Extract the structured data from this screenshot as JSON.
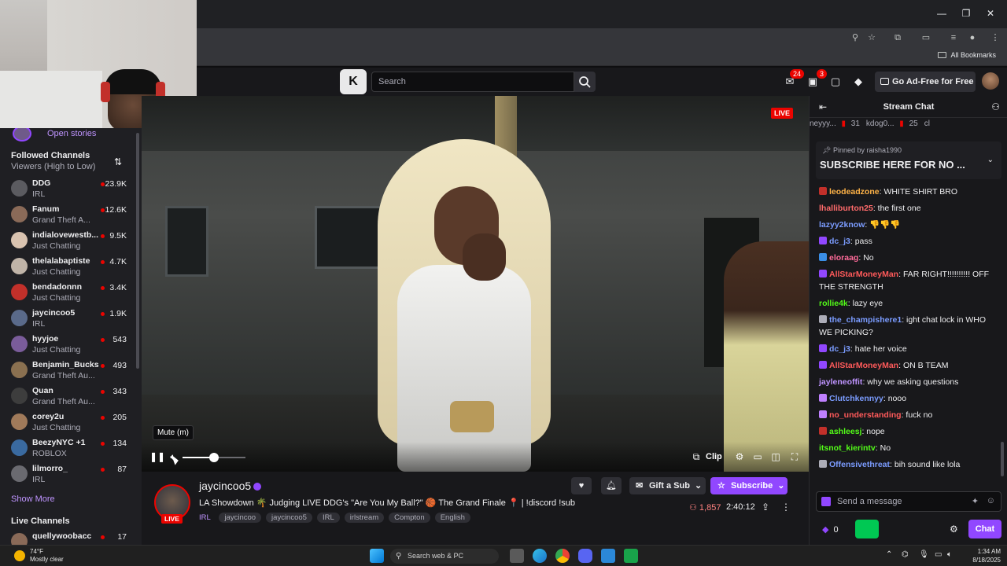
{
  "browser": {
    "all_bookmarks": "All Bookmarks"
  },
  "topnav": {
    "search_placeholder": "Search",
    "notifications_count": "24",
    "messages_count": "3",
    "ad_free_label": "Go Ad-Free for Free"
  },
  "sidebar": {
    "open_stories": "Open stories",
    "followed_title": "Followed Channels",
    "sort_label": "Viewers (High to Low)",
    "channels": [
      {
        "name": "DDG",
        "category": "IRL",
        "viewers": "23.9K",
        "color": "#5b5b60"
      },
      {
        "name": "Fanum",
        "category": "Grand Theft A...",
        "viewers": "12.6K",
        "color": "#8a6a58"
      },
      {
        "name": "indialovewestb...",
        "category": "Just Chatting",
        "viewers": "9.5K",
        "color": "#d9c3b0"
      },
      {
        "name": "thelalabaptiste",
        "category": "Just Chatting",
        "viewers": "4.7K",
        "color": "#c0b4a8"
      },
      {
        "name": "bendadonnn",
        "category": "Just Chatting",
        "viewers": "3.4K",
        "color": "#c2302a"
      },
      {
        "name": "jaycincoo5",
        "category": "IRL",
        "viewers": "1.9K",
        "color": "#5a6a8a"
      },
      {
        "name": "hyyjoe",
        "category": "Just Chatting",
        "viewers": "543",
        "color": "#7a5c9a"
      },
      {
        "name": "Benjamin_Bucks",
        "category": "Grand Theft Au...",
        "viewers": "493",
        "color": "#8a7050"
      },
      {
        "name": "Quan",
        "category": "Grand Theft Au...",
        "viewers": "343",
        "color": "#3d3d3d"
      },
      {
        "name": "corey2u",
        "category": "Just Chatting",
        "viewers": "205",
        "color": "#a07a5a"
      },
      {
        "name": "BeezyNYC +1",
        "category": "ROBLOX",
        "viewers": "134",
        "color": "#3a6aa0"
      },
      {
        "name": "lilmorro_",
        "category": "IRL",
        "viewers": "87",
        "color": "#6a6a70"
      }
    ],
    "show_more": "Show More",
    "live_channels": "Live Channels",
    "live_partial": {
      "name": "quellywoobacc",
      "viewers": "17"
    }
  },
  "video": {
    "live_badge": "LIVE",
    "tooltip": "Mute (m)",
    "volume": 0.5,
    "clip_label": "Clip"
  },
  "stream": {
    "channel_name": "jaycincoo5",
    "live_tag": "LIVE",
    "title": "LA Showdown 🌴 Judging LIVE DDG's \"Are You My Ball?\" 🏀 The Grand Finale 📍 | !discord !sub",
    "category": "IRL",
    "tags": [
      "jaycincoo",
      "jaycincoo5",
      "IRL",
      "irlstream",
      "Compton",
      "English"
    ],
    "gift_label": "Gift a Sub",
    "subscribe_label": "Subscribe",
    "viewer_count": "1,857",
    "uptime": "2:40:12"
  },
  "chat": {
    "title": "Stream Chat",
    "gifters": [
      {
        "name": "neyyy...",
        "count": "31"
      },
      {
        "name": "kdog0...",
        "count": "25"
      },
      {
        "name": "cl",
        "count": ""
      }
    ],
    "pinned_by": "Pinned by",
    "pinned_user": "raisha1990",
    "pinned_message": "SUBSCRIBE HERE FOR NO ...",
    "messages": [
      {
        "user": "leodeadzone",
        "text": ": WHITE SHIRT BRO",
        "color": "#ffb347",
        "badge": "#c2302a"
      },
      {
        "user": "lhalliburton25",
        "text": ": the first one",
        "color": "#ff6b6b",
        "badge": ""
      },
      {
        "user": "lazyy2know",
        "text": ": 👎👎👎",
        "color": "#7b9cff",
        "badge": ""
      },
      {
        "user": "dc_j3",
        "text": ": pass",
        "color": "#7b9cff",
        "badge": "#9147ff"
      },
      {
        "user": "eloraag",
        "text": ": No",
        "color": "#ff6b9a",
        "badge": "#3a8ee6"
      },
      {
        "user": "AllStarMoneyMan",
        "text": ": FAR RIGHT!!!!!!!!!! OFF THE STRENGTH",
        "color": "#ff5a5a",
        "badge": "#9147ff"
      },
      {
        "user": "rollie4k",
        "text": ": lazy eye",
        "color": "#53fc18",
        "badge": ""
      },
      {
        "user": "the_champishere1",
        "text": ": ight chat lock in WHO WE PICKING?",
        "color": "#7b9cff",
        "badge": "#adadb8"
      },
      {
        "user": "dc_j3",
        "text": ": hate her voice",
        "color": "#7b9cff",
        "badge": "#9147ff"
      },
      {
        "user": "AllStarMoneyMan",
        "text": ": ON B TEAM",
        "color": "#ff5a5a",
        "badge": "#9147ff"
      },
      {
        "user": "jayleneoffit",
        "text": ": why we asking questions",
        "color": "#bf94ff",
        "badge": ""
      },
      {
        "user": "Clutchkennyy",
        "text": ": nooo",
        "color": "#7b9cff",
        "badge": "#c080ff"
      },
      {
        "user": "no_understanding",
        "text": ": fuck no",
        "color": "#ff5a5a",
        "badge": "#c080ff"
      },
      {
        "user": "ashleesj",
        "text": ": nope",
        "color": "#53fc18",
        "badge": "#c2302a"
      },
      {
        "user": "itsnot_kierintv",
        "text": ": No",
        "color": "#53fc18",
        "badge": ""
      },
      {
        "user": "Offensivethreat",
        "text": ": bih sound like lola",
        "color": "#7b9cff",
        "badge": "#adadb8"
      }
    ],
    "input_placeholder": "Send a message",
    "points": "0",
    "chat_button": "Chat"
  },
  "taskbar": {
    "temp": "74°F",
    "weather": "Mostly clear",
    "search_label": "Search web & PC",
    "time": "1:34 AM",
    "date": "8/18/2025"
  }
}
